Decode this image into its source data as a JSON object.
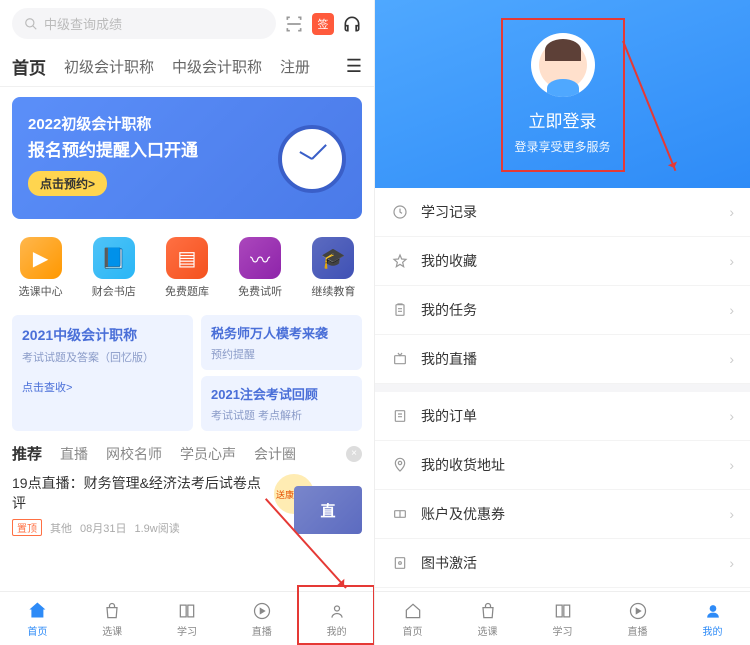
{
  "search": {
    "placeholder": "中级查询成绩"
  },
  "calendar_badge": "签",
  "top_tabs": [
    "首页",
    "初级会计职称",
    "中级会计职称",
    "注册"
  ],
  "banner": {
    "line1": "2022初级会计职称",
    "line2": "报名预约提醒入口开通",
    "button": "点击预约>"
  },
  "quick": [
    {
      "label": "选课中心"
    },
    {
      "label": "财会书店"
    },
    {
      "label": "免费题库"
    },
    {
      "label": "免费试听"
    },
    {
      "label": "继续教育"
    }
  ],
  "card_left": {
    "title": "2021中级会计职称",
    "sub": "考试试题及答案（回忆版）",
    "link": "点击查收>"
  },
  "card_r1": {
    "title": "税务师万人模考来袭",
    "sub": "预约提醒"
  },
  "card_r2": {
    "title": "2021注会考试回顾",
    "sub": "考试试题 考点解析"
  },
  "feed_tabs": [
    "推荐",
    "直播",
    "网校名师",
    "学员心声",
    "会计圈"
  ],
  "feed_item": {
    "title": "19点直播：财务管理&经济法考后试卷点评",
    "badge": "置顶",
    "source": "其他",
    "date": "08月31日",
    "reads": "1.9w阅读",
    "thumb_text": "直",
    "sticker": "送康乃馨"
  },
  "bottom_nav_left": [
    "首页",
    "选课",
    "学习",
    "直播",
    "我的"
  ],
  "login": {
    "title": "立即登录",
    "sub": "登录享受更多服务"
  },
  "menu_g1": [
    "学习记录",
    "我的收藏",
    "我的任务",
    "我的直播"
  ],
  "menu_g2": [
    "我的订单",
    "我的收货地址",
    "账户及优惠券",
    "图书激活"
  ],
  "bottom_nav_right": [
    "首页",
    "选课",
    "学习",
    "直播",
    "我的"
  ]
}
